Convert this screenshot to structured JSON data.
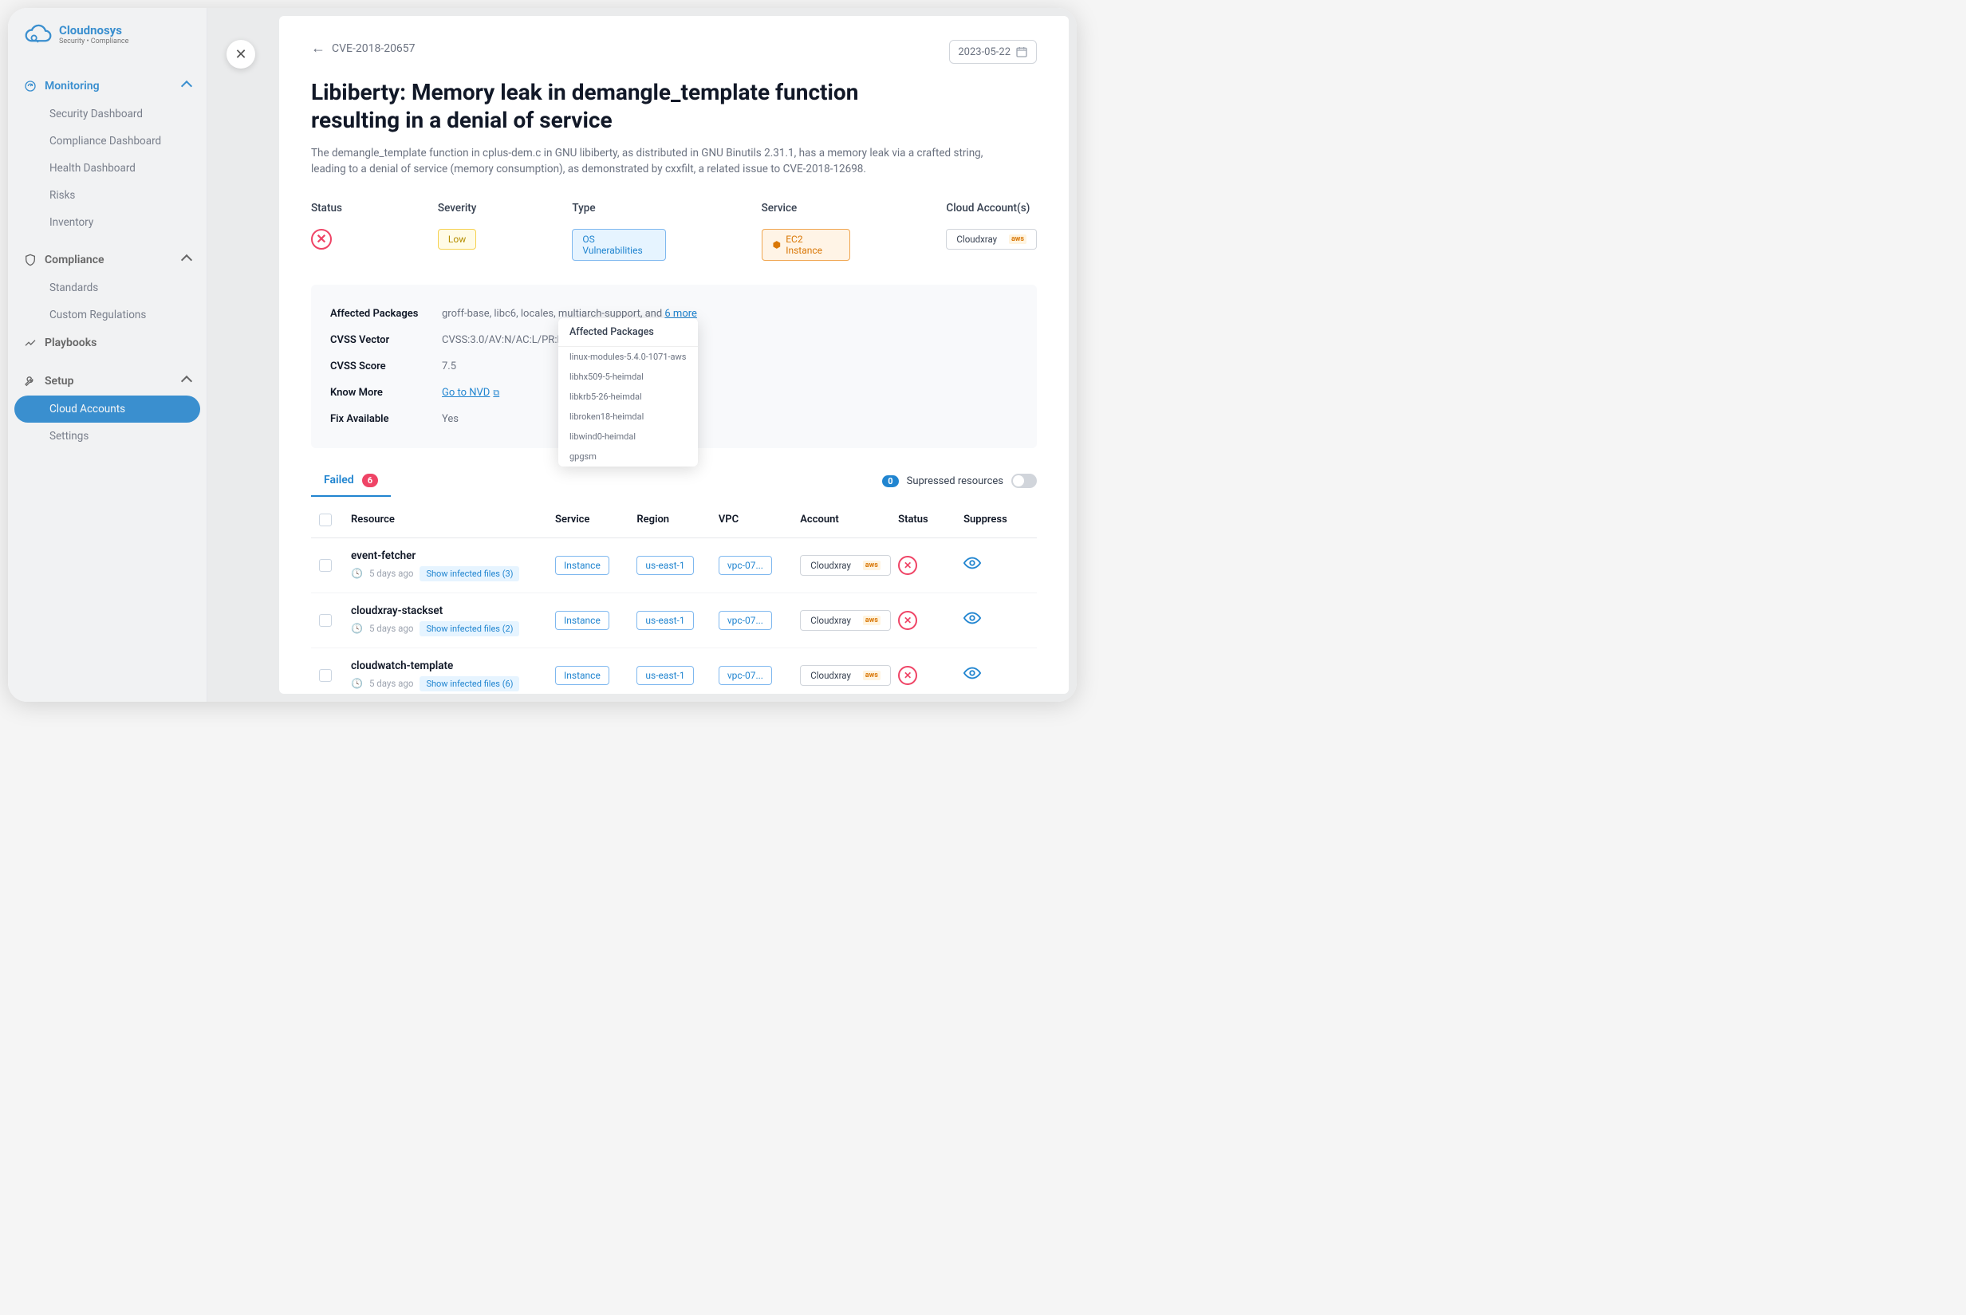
{
  "brand": {
    "name": "Cloudnosys",
    "tagline": "Security • Compliance"
  },
  "sidebar": {
    "sections": [
      {
        "label": "Monitoring",
        "items": [
          {
            "label": "Security Dashboard"
          },
          {
            "label": "Compliance Dashboard"
          },
          {
            "label": "Health Dashboard"
          },
          {
            "label": "Risks"
          },
          {
            "label": "Inventory"
          }
        ]
      },
      {
        "label": "Compliance",
        "items": [
          {
            "label": "Standards"
          },
          {
            "label": "Custom Regulations"
          }
        ]
      },
      {
        "label": "Playbooks"
      },
      {
        "label": "Setup",
        "items": [
          {
            "label": "Cloud Accounts",
            "active": true
          },
          {
            "label": "Settings"
          }
        ]
      }
    ]
  },
  "drawer": {
    "cve_id": "CVE-2018-20657",
    "date": "2023-05-22",
    "title": "Libiberty: Memory leak in demangle_template function resulting in a denial of service",
    "description": "The demangle_template function in cplus-dem.c in GNU libiberty, as distributed in GNU Binutils 2.31.1, has a memory leak via a crafted string, leading to a denial of service (memory consumption), as demonstrated by cxxfilt, a related issue to CVE-2018-12698.",
    "summary": {
      "status_label": "Status",
      "severity_label": "Severity",
      "severity_value": "Low",
      "type_label": "Type",
      "type_value": "OS Vulnerabilities",
      "service_label": "Service",
      "service_value": "EC2 Instance",
      "accounts_label": "Cloud Account(s)",
      "account_value": "Cloudxray",
      "account_provider": "aws"
    },
    "details": {
      "affected_label": "Affected Packages",
      "affected_value": "groff-base, libc6, locales, multiarch-support, and ",
      "affected_more": "6 more",
      "vector_label": "CVSS Vector",
      "vector_value": "CVSS:3.0/AV:N/AC:L/PR:N/UI:N/",
      "score_label": "CVSS Score",
      "score_value": "7.5",
      "know_label": "Know More",
      "know_link": "Go to NVD",
      "fix_label": "Fix Available",
      "fix_value": "Yes"
    },
    "popover": {
      "title": "Affected Packages",
      "items": [
        "linux-modules-5.4.0-1071-aws",
        "libhx509-5-heimdal",
        "libkrb5-26-heimdal",
        "libroken18-heimdal",
        "libwind0-heimdal",
        "gpgsm"
      ]
    },
    "tabs": {
      "failed": "Failed",
      "failed_count": "6",
      "suppressed_label": "Supressed resources",
      "suppressed_count": "0"
    },
    "table": {
      "headers": {
        "resource": "Resource",
        "service": "Service",
        "region": "Region",
        "vpc": "VPC",
        "account": "Account",
        "status": "Status",
        "suppress": "Suppress"
      },
      "rows": [
        {
          "name": "event-fetcher",
          "age": "5 days ago",
          "infected": "Show infected files (3)",
          "service": "Instance",
          "region": "us-east-1",
          "vpc": "vpc-07...",
          "account": "Cloudxray",
          "provider": "aws"
        },
        {
          "name": "cloudxray-stackset",
          "age": "5 days ago",
          "infected": "Show infected files (2)",
          "service": "Instance",
          "region": "us-east-1",
          "vpc": "vpc-07...",
          "account": "Cloudxray",
          "provider": "aws"
        },
        {
          "name": "cloudwatch-template",
          "age": "5 days ago",
          "infected": "Show infected files (6)",
          "service": "Instance",
          "region": "us-east-1",
          "vpc": "vpc-07...",
          "account": "Cloudxray",
          "provider": "aws"
        }
      ]
    }
  }
}
